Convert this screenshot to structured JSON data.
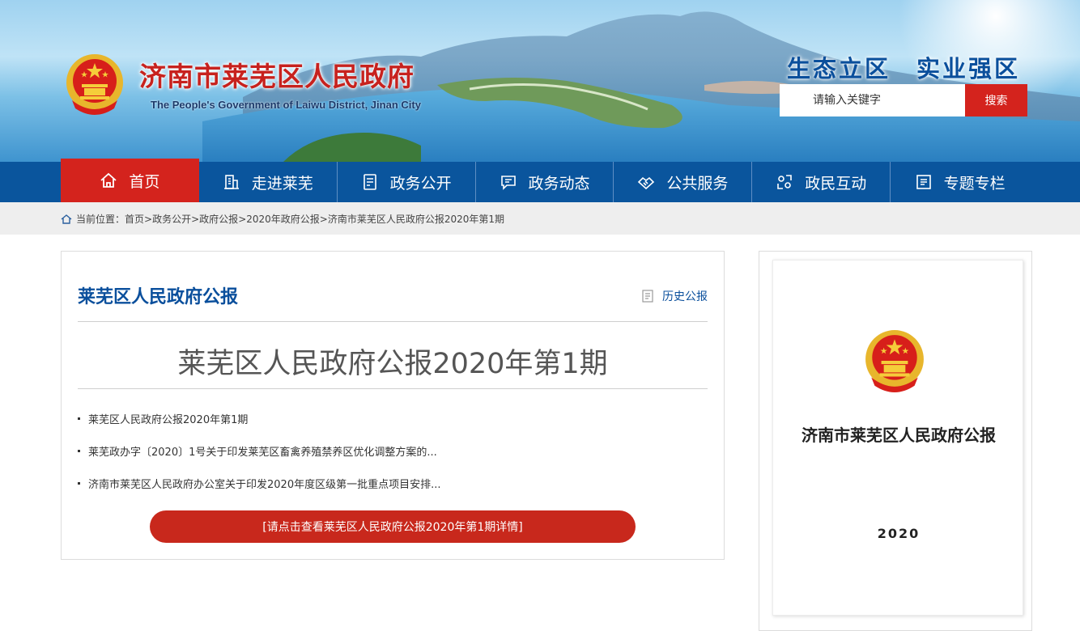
{
  "header": {
    "title": "济南市莱芜区人民政府",
    "subtitle": "The People's Government of Laiwu District, Jinan City",
    "slogan_1": "生态立区",
    "slogan_2": "实业强区",
    "search_placeholder": "请输入关键字",
    "search_button": "搜索"
  },
  "nav": {
    "items": [
      {
        "label": "首页",
        "icon": "home-icon"
      },
      {
        "label": "走进莱芜",
        "icon": "building-icon"
      },
      {
        "label": "政务公开",
        "icon": "document-icon"
      },
      {
        "label": "政务动态",
        "icon": "chat-icon"
      },
      {
        "label": "公共服务",
        "icon": "handshake-icon"
      },
      {
        "label": "政民互动",
        "icon": "interaction-icon"
      },
      {
        "label": "专题专栏",
        "icon": "list-icon"
      }
    ]
  },
  "breadcrumb": {
    "prefix": "当前位置：",
    "items": [
      "首页",
      "政务公开",
      "政府公报",
      "2020年政府公报",
      "济南市莱芜区人民政府公报2020年第1期"
    ],
    "separator": ">"
  },
  "main": {
    "panel_title": "莱芜区人民政府公报",
    "history_link": "历史公报",
    "issue_title": "莱芜区人民政府公报2020年第1期",
    "articles": [
      "莱芜区人民政府公报2020年第1期",
      "莱芜政办字〔2020〕1号关于印发莱芜区畜禽养殖禁养区优化调整方案的...",
      "济南市莱芜区人民政府办公室关于印发2020年度区级第一批重点项目安排..."
    ],
    "detail_button": "[请点击查看莱芜区人民政府公报2020年第1期详情]"
  },
  "cover": {
    "title": "济南市莱芜区人民政府公报",
    "year": "2020"
  },
  "colors": {
    "nav_blue": "#0a559d",
    "accent_red": "#d4231d",
    "title_blue": "#0a4f9c"
  }
}
